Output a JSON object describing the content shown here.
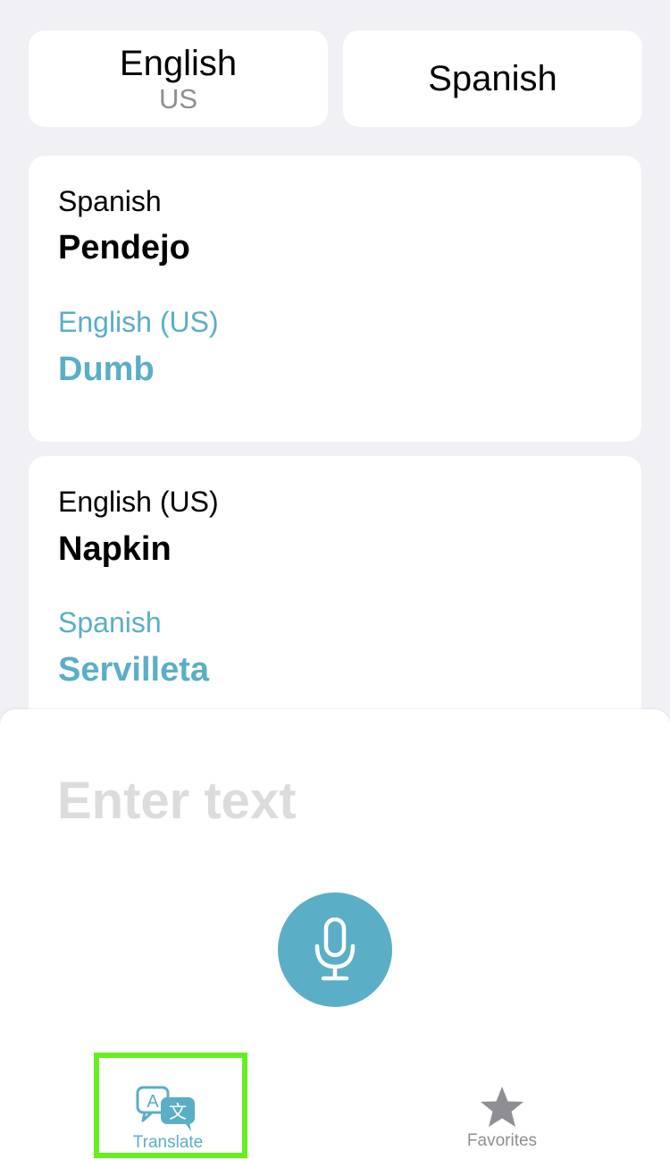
{
  "languages": {
    "source": {
      "name": "English",
      "region": "US"
    },
    "target": {
      "name": "Spanish"
    }
  },
  "history": [
    {
      "source_language": "Spanish",
      "source_text": "Pendejo",
      "target_language": "English (US)",
      "target_text": "Dumb"
    },
    {
      "source_language": "English (US)",
      "source_text": "Napkin",
      "target_language": "Spanish",
      "target_text": "Servilleta"
    }
  ],
  "input": {
    "placeholder": "Enter text",
    "value": ""
  },
  "tabs": {
    "translate": {
      "label": "Translate",
      "icon": "translate-icon",
      "active": true
    },
    "favorites": {
      "label": "Favorites",
      "icon": "star-icon",
      "active": false
    }
  },
  "colors": {
    "accent": "#5aaec6",
    "background": "#f0f0f5",
    "highlight": "#66ee22",
    "inactive": "#8e8e93"
  }
}
